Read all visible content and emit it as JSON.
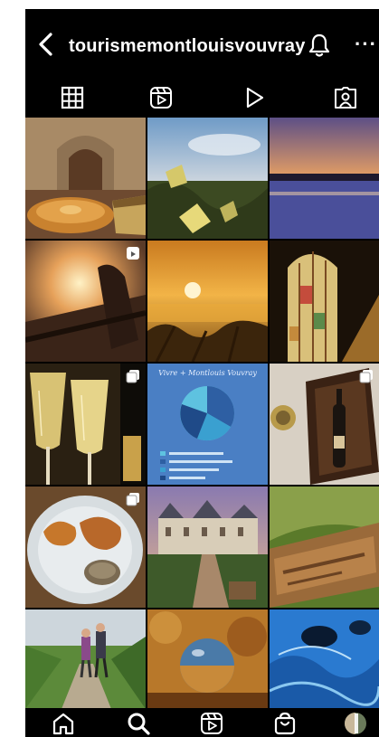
{
  "header": {
    "username": "tourismemontlouisvouvray",
    "more_label": "···"
  },
  "icons": {
    "back": "chevron-left-icon",
    "notifications": "bell-icon",
    "more": "more-icon",
    "grid_tab": "grid-icon",
    "reels_tab": "reels-icon",
    "videos_tab": "play-icon",
    "tagged_tab": "tagged-person-icon",
    "home": "home-icon",
    "search": "search-icon",
    "reels": "reels-icon",
    "shop": "shopping-bag-icon",
    "profile": "avatar"
  },
  "infographic": {
    "title": "Vivre + Montlouis Vouvray"
  },
  "colors": {
    "background": "#000000",
    "text": "#ffffff",
    "infographic_bg": "#4a7fc4"
  }
}
